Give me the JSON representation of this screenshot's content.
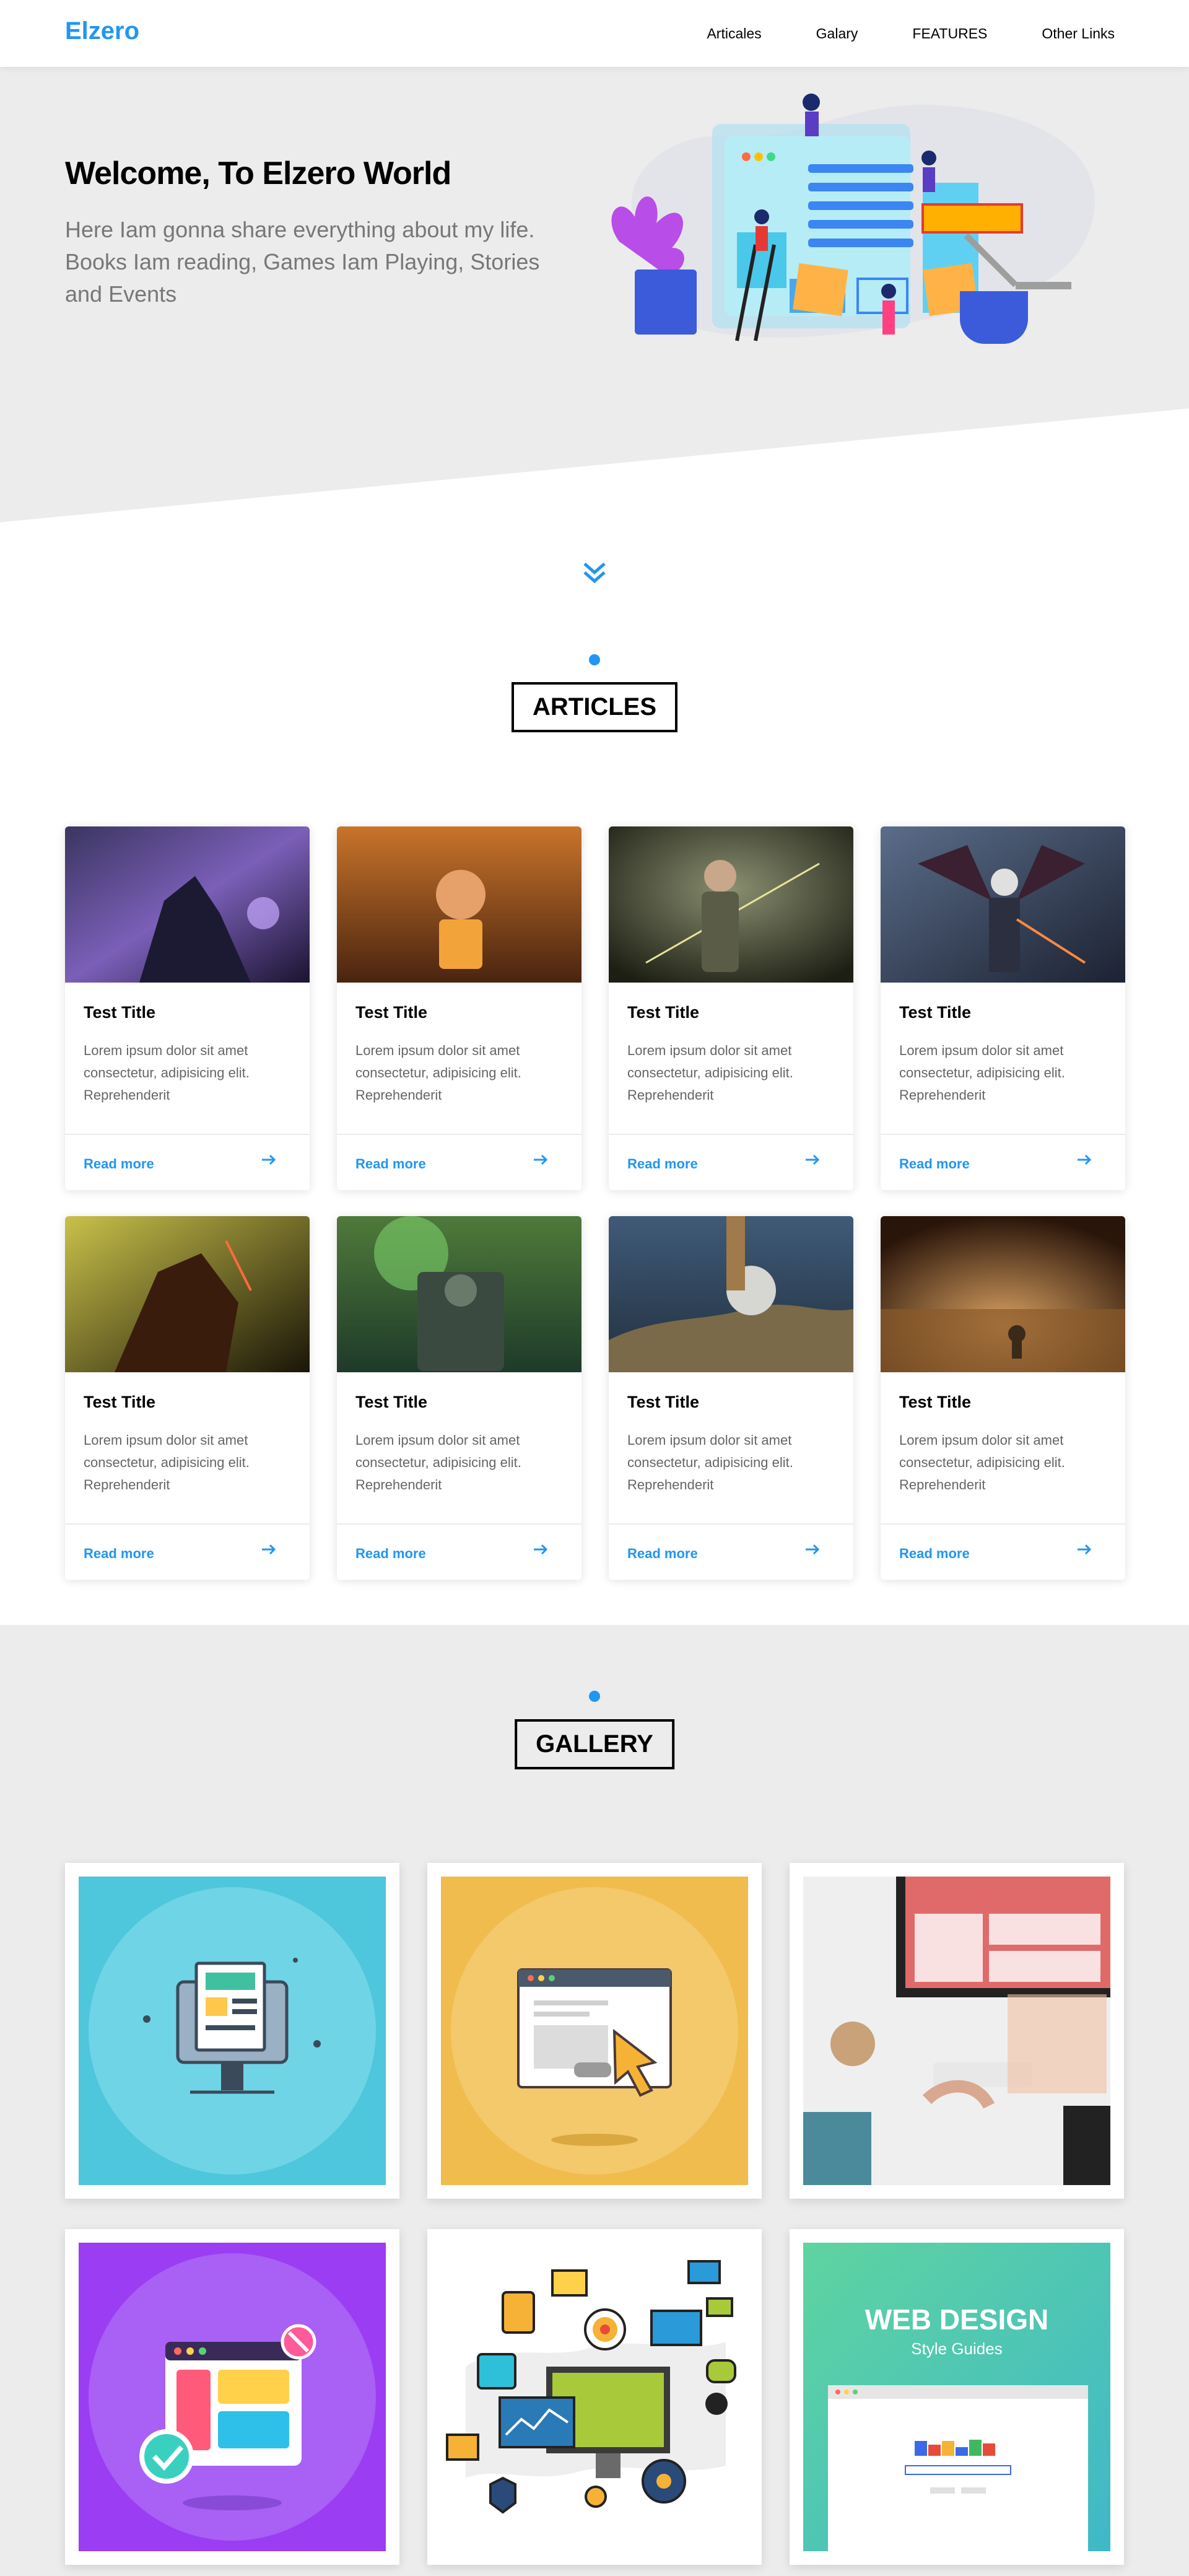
{
  "header": {
    "logo": "Elzero",
    "nav": [
      "Articales",
      "Galary",
      "FEATURES",
      "Other Links"
    ]
  },
  "landing": {
    "title": "Welcome, To Elzero World",
    "text": "Here Iam gonna share everything about my life. Books Iam reading, Games Iam Playing, Stories and Events"
  },
  "articles": {
    "section_title": "ARTICLES",
    "cards": [
      {
        "title": "Test Title",
        "text": "Lorem ipsum dolor sit amet consectetur, adipisicing elit. Reprehenderit",
        "link": "Read more"
      },
      {
        "title": "Test Title",
        "text": "Lorem ipsum dolor sit amet consectetur, adipisicing elit. Reprehenderit",
        "link": "Read more"
      },
      {
        "title": "Test Title",
        "text": "Lorem ipsum dolor sit amet consectetur, adipisicing elit. Reprehenderit",
        "link": "Read more"
      },
      {
        "title": "Test Title",
        "text": "Lorem ipsum dolor sit amet consectetur, adipisicing elit. Reprehenderit",
        "link": "Read more"
      },
      {
        "title": "Test Title",
        "text": "Lorem ipsum dolor sit amet consectetur, adipisicing elit. Reprehenderit",
        "link": "Read more"
      },
      {
        "title": "Test Title",
        "text": "Lorem ipsum dolor sit amet consectetur, adipisicing elit. Reprehenderit",
        "link": "Read more"
      },
      {
        "title": "Test Title",
        "text": "Lorem ipsum dolor sit amet consectetur, adipisicing elit. Reprehenderit",
        "link": "Read more"
      },
      {
        "title": "Test Title",
        "text": "Lorem ipsum dolor sit amet consectetur, adipisicing elit. Reprehenderit",
        "link": "Read more"
      }
    ]
  },
  "gallery": {
    "section_title": "GALLERY",
    "tiles": [
      {
        "icon": "monitor-document-icon"
      },
      {
        "icon": "browser-cursor-icon"
      },
      {
        "icon": "desk-workspace-icon"
      },
      {
        "icon": "browser-check-icon"
      },
      {
        "icon": "digital-marketing-icon"
      },
      {
        "icon": "web-design-style-guide-icon",
        "heading": "WEB DESIGN",
        "subheading": "Style Guides"
      }
    ]
  },
  "colors": {
    "accent": "#2196f3",
    "landing_bg": "#ececec",
    "gallery_bg": "#ececec"
  }
}
